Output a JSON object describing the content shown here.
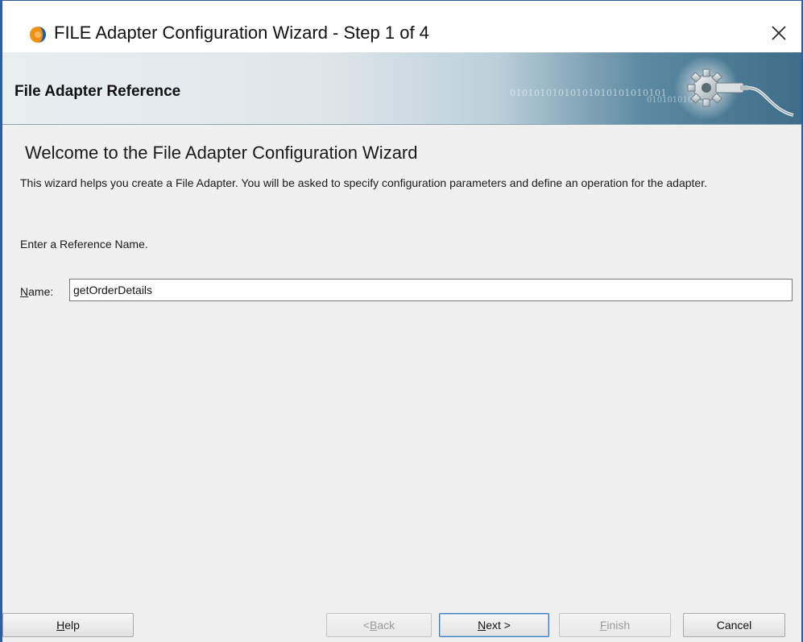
{
  "window": {
    "title": "FILE Adapter Configuration Wizard - Step 1 of 4",
    "close_glyph": "✕",
    "accent_color": "#2f5e9f"
  },
  "banner": {
    "title": "File Adapter Reference",
    "binary_text_1": "01010101010101010101010101",
    "binary_text_2": "01010101010",
    "graphic_icon": "gear-plug-icon"
  },
  "content": {
    "heading": "Welcome to the File Adapter Configuration Wizard",
    "description": "This wizard helps you create a File Adapter. You will be asked to specify configuration parameters and define an operation for the adapter.",
    "prompt": "Enter a Reference Name.",
    "name_label_mnemonic": "N",
    "name_label_rest": "ame:",
    "name_value": "getOrderDetails"
  },
  "buttons": {
    "help_mnemonic": "H",
    "help_rest": "elp",
    "back_prefix": "< ",
    "back_mnemonic": "B",
    "back_rest": "ack",
    "next_mnemonic": "N",
    "next_rest": "ext >",
    "finish_mnemonic": "F",
    "finish_rest": "inish",
    "cancel_label": "Cancel"
  }
}
